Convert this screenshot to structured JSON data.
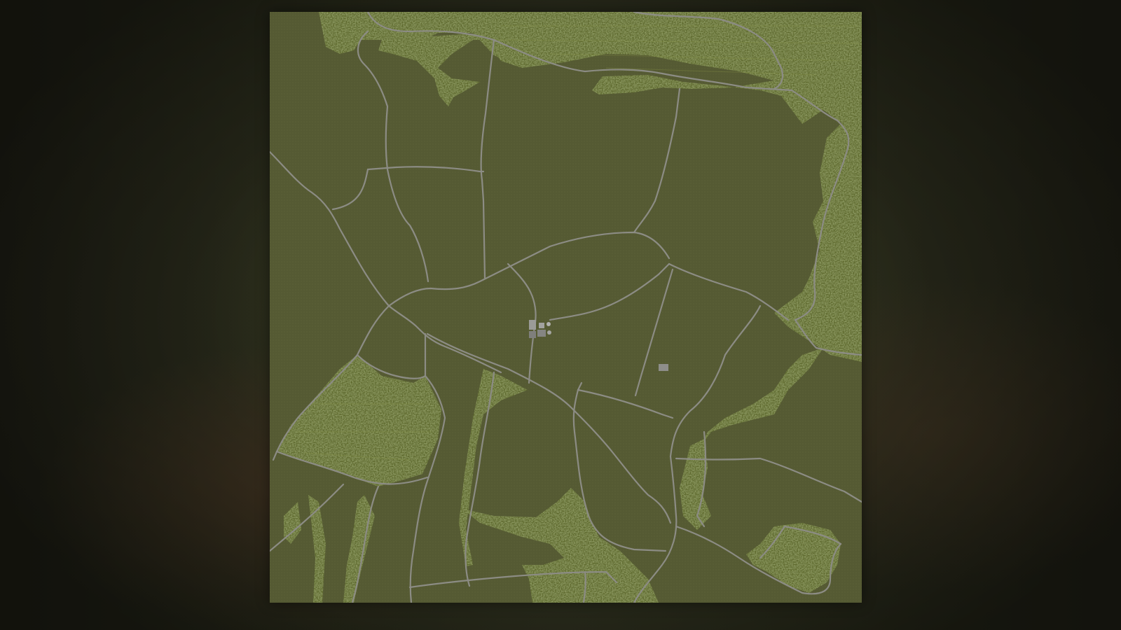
{
  "map": {
    "kind": "farm-overview-map",
    "colors": {
      "field": "#555a33",
      "forest": "#5f6a2e",
      "forest_dark": "#434d1e",
      "forest_light": "#7f8a44",
      "road": "#8c8c84",
      "building": "#9a9a98",
      "backdrop": "#2a2a1c"
    },
    "icons": [
      "forest-area",
      "farm-buildings",
      "field-marker"
    ]
  }
}
